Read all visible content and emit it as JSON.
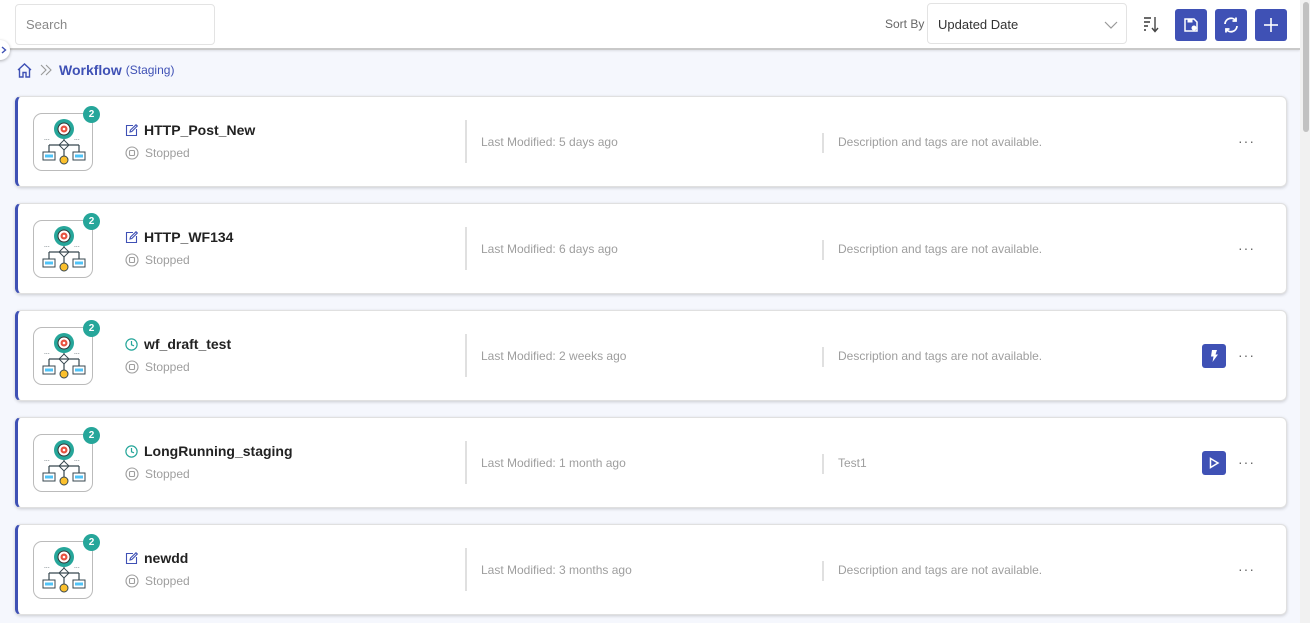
{
  "toolbar": {
    "search_placeholder": "Search",
    "search_value": "",
    "sort_by_label": "Sort By",
    "sort_by_value": "Updated Date",
    "buttons": [
      {
        "name": "save-settings",
        "icon": "save-gear-icon"
      },
      {
        "name": "refresh",
        "icon": "refresh-icon"
      },
      {
        "name": "add",
        "icon": "plus-icon"
      }
    ]
  },
  "breadcrumb": {
    "home_icon": "home-icon",
    "separator_icon": "double-chevron-right-icon",
    "title": "Workflow",
    "subtitle": "(Staging)"
  },
  "colors": {
    "accent": "#3f51b5",
    "badge": "#26a69a",
    "muted_text": "#9e9e9e"
  },
  "workflows": [
    {
      "name": "HTTP_Post_New",
      "type_icon": "edit-icon",
      "status": "Stopped",
      "badge": "2",
      "last_modified": "Last Modified: 5 days ago",
      "description": "Description and tags are not available.",
      "action": null
    },
    {
      "name": "HTTP_WF134",
      "type_icon": "edit-icon",
      "status": "Stopped",
      "badge": "2",
      "last_modified": "Last Modified: 6 days ago",
      "description": "Description and tags are not available.",
      "action": null
    },
    {
      "name": "wf_draft_test",
      "type_icon": "clock-icon",
      "status": "Stopped",
      "badge": "2",
      "last_modified": "Last Modified: 2 weeks ago",
      "description": "Description and tags are not available.",
      "action": "lightning-icon"
    },
    {
      "name": "LongRunning_staging",
      "type_icon": "clock-icon",
      "status": "Stopped",
      "badge": "2",
      "last_modified": "Last Modified: 1 month ago",
      "description": "Test1",
      "action": "play-icon"
    },
    {
      "name": "newdd",
      "type_icon": "edit-icon",
      "status": "Stopped",
      "badge": "2",
      "last_modified": "Last Modified: 3 months ago",
      "description": "Description and tags are not available.",
      "action": null
    }
  ],
  "more_label": "···"
}
